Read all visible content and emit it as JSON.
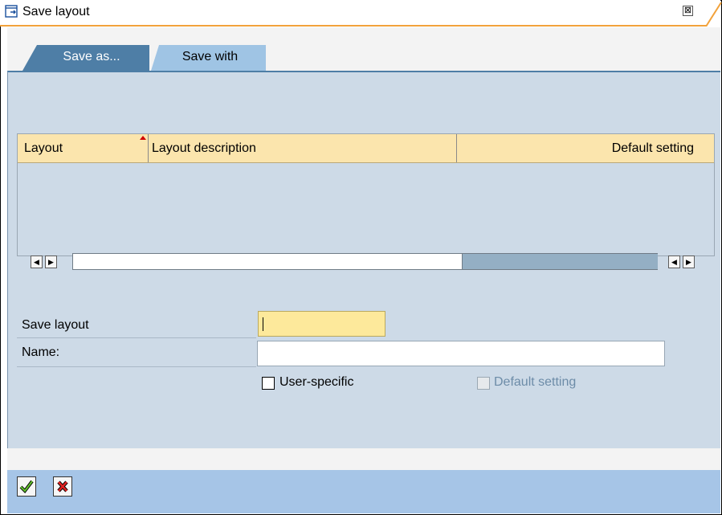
{
  "window": {
    "title": "Save layout",
    "close_glyph": "⊠",
    "icon": "window-edit-icon"
  },
  "tabs": [
    {
      "label": "Save as...",
      "active": true
    },
    {
      "label": "Save with",
      "active": false
    }
  ],
  "table": {
    "columns": [
      "Layout",
      "Layout description",
      "Default setting"
    ],
    "rows": [],
    "sort_indicator_color": "#d00000"
  },
  "form": {
    "save_layout_label": "Save layout",
    "save_layout_value": "",
    "name_label": "Name:",
    "name_value": "",
    "user_specific_label": "User-specific",
    "user_specific_checked": false,
    "default_setting_label": "Default setting",
    "default_setting_checked": false,
    "default_setting_enabled": false
  },
  "footer": {
    "confirm_icon": "checkmark-icon",
    "cancel_icon": "cancel-x-icon"
  },
  "colors": {
    "accent_orange": "#f2a23b",
    "tab_active": "#4e7ea6",
    "tab_inactive": "#9fc4e4",
    "panel": "#cddae7",
    "grid_header": "#fbe5ad",
    "input_required": "#fde99b",
    "footer": "#a6c5e7"
  }
}
